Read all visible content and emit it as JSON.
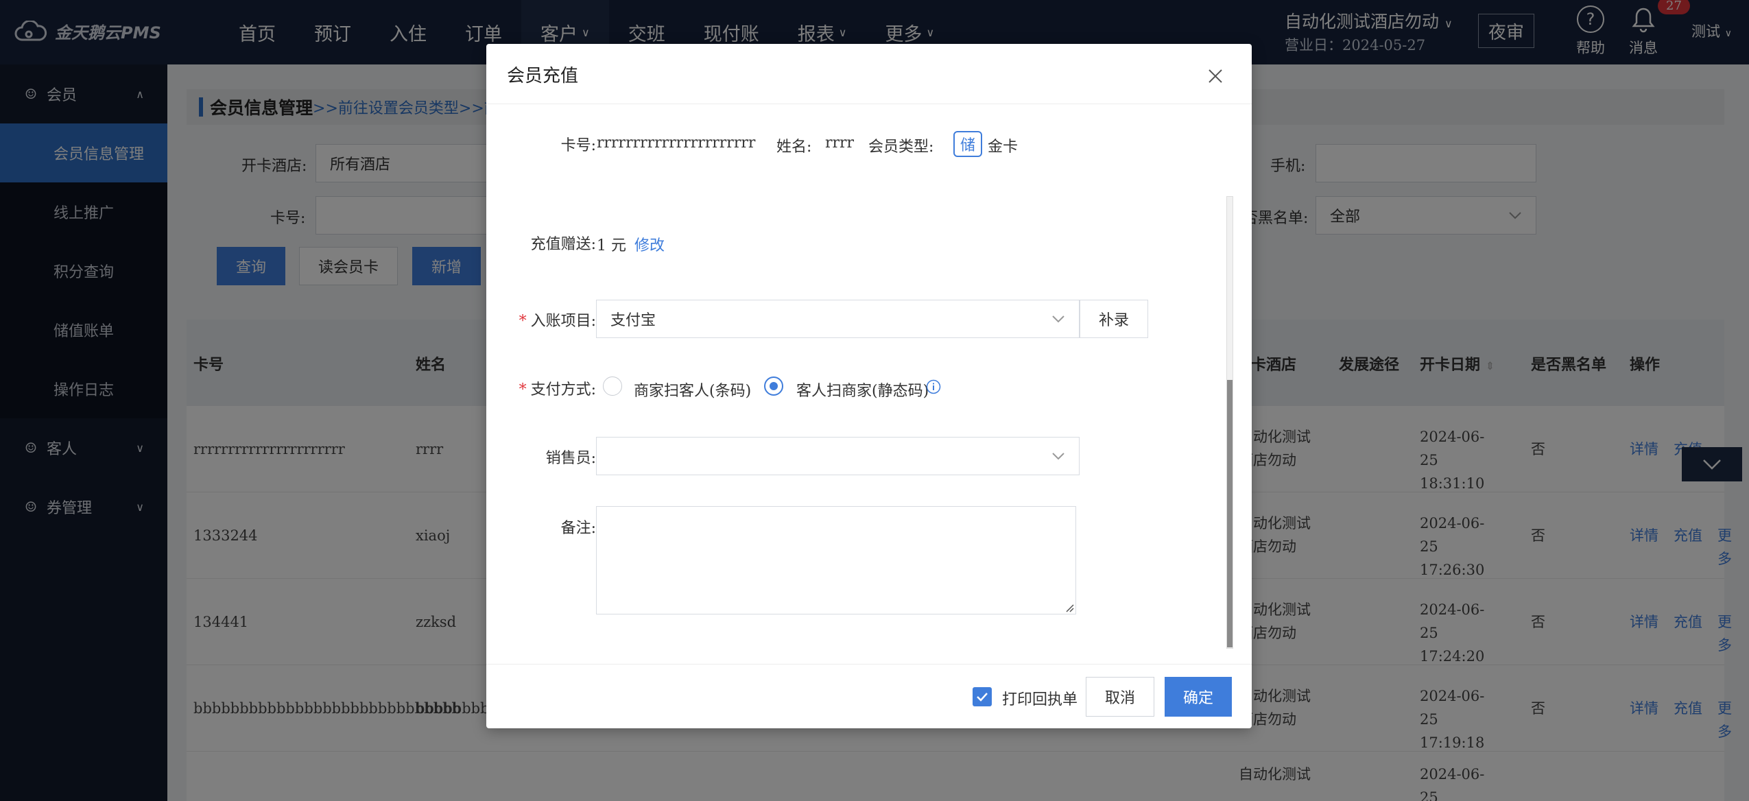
{
  "app": {
    "logo_text": "金天鹅云PMS"
  },
  "nav": [
    {
      "label": "首页",
      "has_menu": false
    },
    {
      "label": "预订",
      "has_menu": false
    },
    {
      "label": "入住",
      "has_menu": false
    },
    {
      "label": "订单",
      "has_menu": false
    },
    {
      "label": "客户",
      "has_menu": true
    },
    {
      "label": "交班",
      "has_menu": false
    },
    {
      "label": "现付账",
      "has_menu": false
    },
    {
      "label": "报表",
      "has_menu": true
    },
    {
      "label": "更多",
      "has_menu": true
    }
  ],
  "header": {
    "hotel_name": "自动化测试酒店勿动",
    "business_day": "营业日：2024-05-27",
    "night_audit": "夜审",
    "help": "帮助",
    "messages": "消息",
    "message_count": "27",
    "user": "测试"
  },
  "sidebar": {
    "group_member": "会员",
    "items": [
      "会员信息管理",
      "线上推广",
      "积分查询",
      "储值账单",
      "操作日志"
    ],
    "group_customer": "客人",
    "group_coupon": "券管理"
  },
  "page": {
    "title": "会员信息管理",
    "title_link": ">>前往设置会员类型>>前",
    "label_hotel": "开卡酒店:",
    "hotel_value": "所有酒店",
    "label_phone": "手机:",
    "label_card": "卡号:",
    "label_blacklist": "否黑名单:",
    "blacklist_value": "全部",
    "btn_query": "查询",
    "btn_read": "读会员卡",
    "btn_new": "新增"
  },
  "table": {
    "headers": {
      "card": "卡号",
      "name": "姓名",
      "hotel": "开卡酒店",
      "source": "发展途径",
      "date": "开卡日期",
      "blacklist": "是否黑名单",
      "ops": "操作"
    },
    "rows": [
      {
        "card": "rrrrrrrrrrrrrrrrrrrrrr",
        "name": "rrrr",
        "hotel": "自动化测试酒店勿动",
        "date": "2024-06-25",
        "time": "18:31:10",
        "blacklist": "否"
      },
      {
        "card": "1333244",
        "name": "xiaoj",
        "hotel": "自动化测试酒店勿动",
        "date": "2024-06-25",
        "time": "17:26:30",
        "blacklist": "否"
      },
      {
        "card": "134441",
        "name": "zzksd",
        "hotel": "自动化测试酒店勿动",
        "date": "2024-06-25",
        "time": "17:24:20",
        "blacklist": "否"
      },
      {
        "card": "bbbbbbbbbbbbbbbbbbbbbbbbbbbbb",
        "name": "bbbbbbbbbb",
        "hotel": "自动化测试酒店勿动",
        "date": "2024-06-25",
        "time": "17:19:18",
        "blacklist": "否"
      },
      {
        "card": "",
        "name": "",
        "hotel": "自动化测试",
        "date": "2024-06-25",
        "time": "",
        "blacklist": ""
      }
    ],
    "op_detail": "详情",
    "op_recharge": "充值",
    "op_more": "更多"
  },
  "modal": {
    "title": "会员充值",
    "label_card": "卡号:",
    "card_value": "rrrrrrrrrrrrrrrrrrrrrr",
    "label_name": "姓名:",
    "name_value": "rrrr",
    "label_type": "会员类型:",
    "type_tag": "储",
    "type_value": "金卡",
    "label_gift": "充值赠送:",
    "gift_value": "1 元",
    "gift_edit": "修改",
    "label_item": "入账项目:",
    "item_value": "支付宝",
    "btn_supplement": "补录",
    "label_pay": "支付方式:",
    "pay_option1": "商家扫客人(条码)",
    "pay_option2": "客人扫商家(静态码)",
    "label_sales": "销售员:",
    "sales_value": "",
    "label_remark": "备注:",
    "remark_value": "",
    "print_receipt": "打印回执单",
    "btn_cancel": "取消",
    "btn_ok": "确定"
  }
}
